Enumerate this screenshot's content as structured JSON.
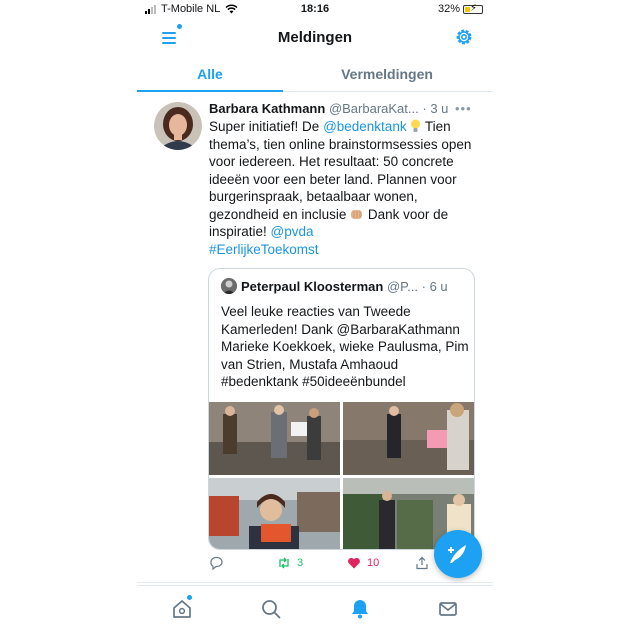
{
  "status_bar": {
    "carrier": "T-Mobile NL",
    "time": "18:16",
    "battery_percent": "32%",
    "battery_level": 0.32
  },
  "header": {
    "title": "Meldingen"
  },
  "tabs": [
    {
      "label": "Alle",
      "active": true
    },
    {
      "label": "Vermeldingen",
      "active": false
    }
  ],
  "tweet": {
    "author_name": "Barbara Kathmann",
    "author_handle": "@BarbaraKat...",
    "separator": "·",
    "time": "3 u",
    "body": {
      "p1": "Super initiatief! De ",
      "mention1": "@bedenktank",
      "p2": " Tien thema’s, tien online brainstormsessies open voor iedereen. Het resultaat: 50 concrete ideeën voor een beter land. Plannen voor burgerinspraak, betaalbaar wonen, gezondheid en inclusie ",
      "p3": " Dank voor de inspiratie! ",
      "mention2": "@pvda",
      "hashtag": "#EerlijkeToekomst"
    },
    "quote": {
      "author_name": "Peterpaul Kloosterman",
      "author_handle": "@P...",
      "separator": "·",
      "time": "6 u",
      "text": "Veel leuke reacties van Tweede Kamerleden! Dank @BarbaraKathmann Marieke Koekkoek, wieke Paulusma, Pim van Strien, Mustafa Amhaoud #bedenktank #50ideeënbundel"
    },
    "actions": {
      "retweet_count": "3",
      "like_count": "10"
    }
  },
  "colors": {
    "accent": "#1da1f2",
    "retweet": "#17bf63",
    "like": "#e0245e",
    "secondary_text": "#657786"
  },
  "icons": {
    "menu": "menu-icon",
    "settings": "gear-icon",
    "compose": "compose-icon",
    "home": "home-icon",
    "search": "search-icon",
    "notifications": "bell-icon",
    "messages": "mail-icon"
  }
}
